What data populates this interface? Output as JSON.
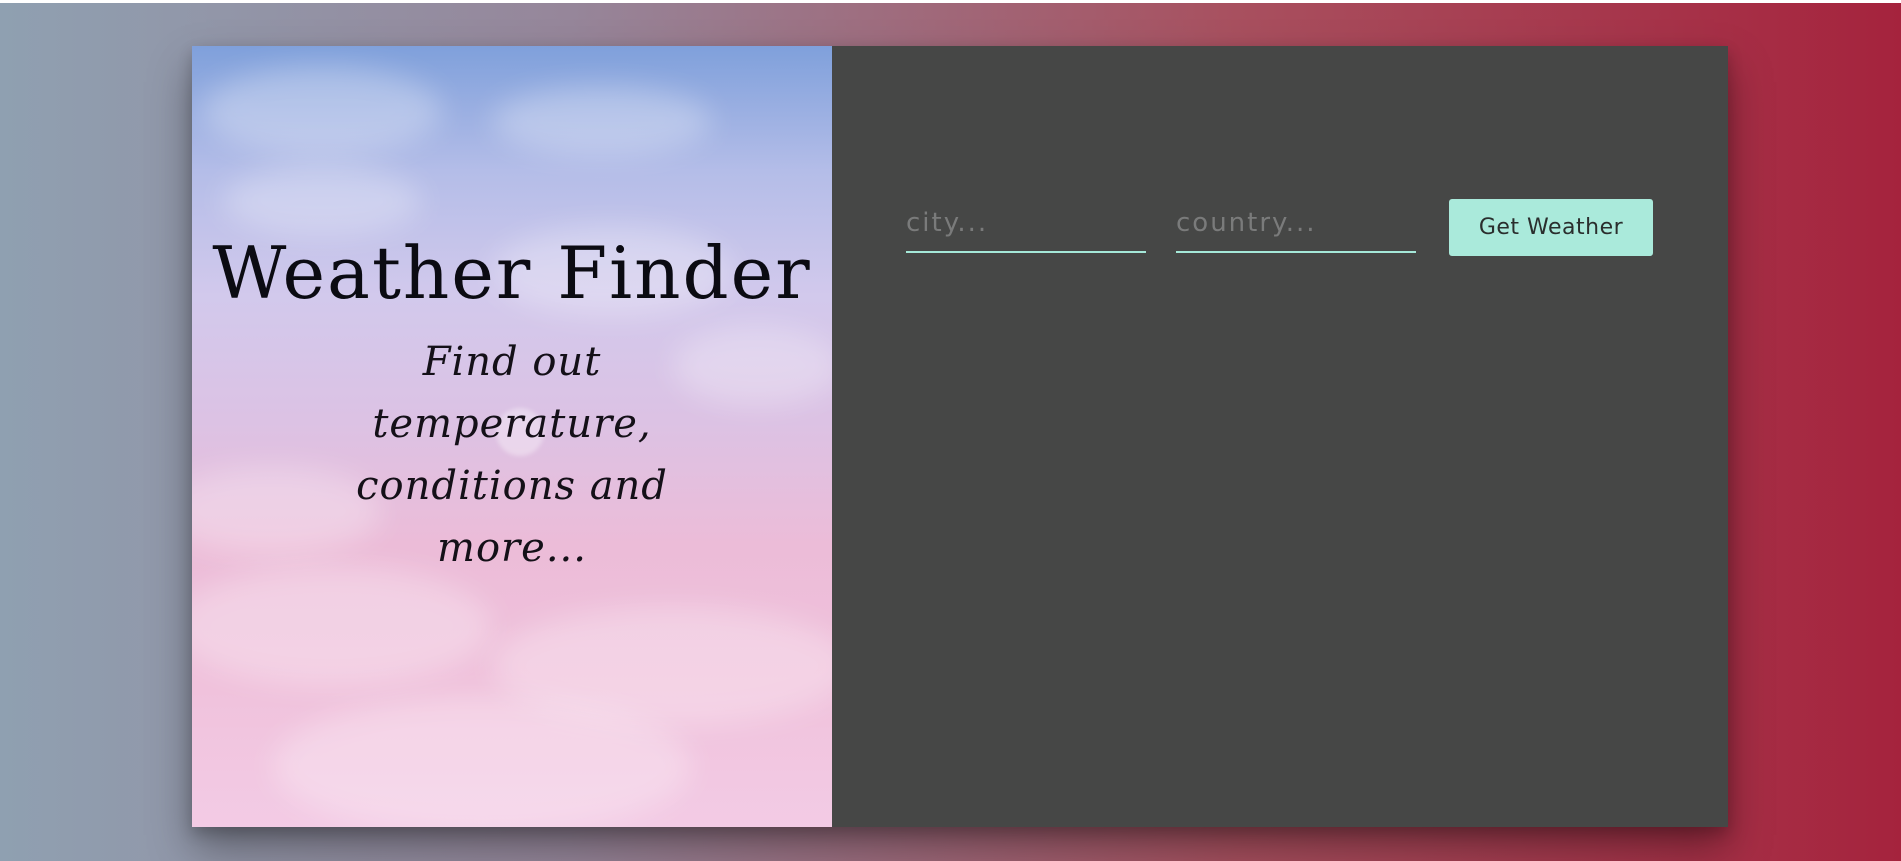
{
  "theme": {
    "accent": "#aaeadb",
    "panel_background": "#464746",
    "background_gradient": [
      "#8fa0b1",
      "#a5233d"
    ]
  },
  "hero": {
    "title": "Weather Finder",
    "subtitle": "Find out temperature, conditions and more..."
  },
  "form": {
    "city_placeholder": "city...",
    "city_value": "",
    "country_placeholder": "country...",
    "country_value": "",
    "submit_label": "Get Weather"
  }
}
